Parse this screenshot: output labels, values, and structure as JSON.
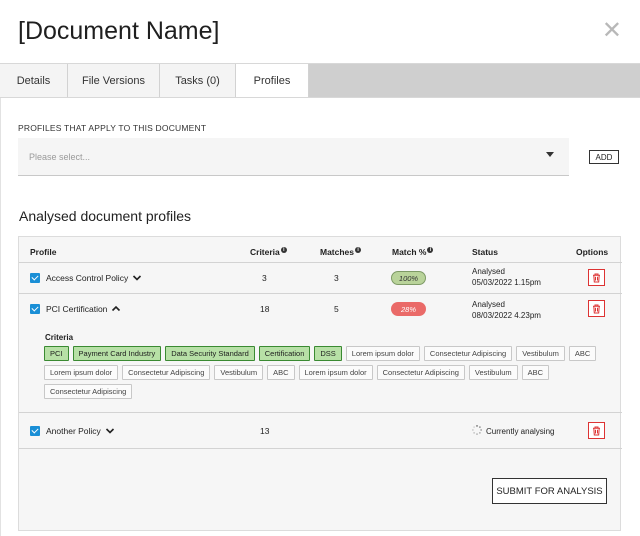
{
  "header": {
    "title": "[Document Name]",
    "close_glyph": "✕"
  },
  "tabs": [
    {
      "label": "Details"
    },
    {
      "label": "File Versions"
    },
    {
      "label": "Tasks (0)"
    },
    {
      "label": "Profiles",
      "active": true
    }
  ],
  "profiles_section": {
    "label": "PROFILES THAT APPLY TO THIS DOCUMENT",
    "select_placeholder": "Please select...",
    "add_label": "ADD"
  },
  "analysed": {
    "heading": "Analysed document profiles",
    "columns": {
      "profile": "Profile",
      "criteria": "Criteria",
      "matches": "Matches",
      "match_pct": "Match %",
      "status": "Status",
      "options": "Options"
    },
    "rows": [
      {
        "name": "Access Control Policy",
        "criteria": "3",
        "matches": "3",
        "match": "100%",
        "status_line1": "Analysed",
        "status_line2": "05/03/2022  1.15pm"
      },
      {
        "name": "PCI Certification",
        "criteria": "18",
        "matches": "5",
        "match": "28%",
        "status_line1": "Analysed",
        "status_line2": "08/03/2022  4.23pm",
        "criteria_label": "Criteria",
        "tags": [
          {
            "text": "PCI",
            "hl": true
          },
          {
            "text": "Payment Card Industry",
            "hl": true
          },
          {
            "text": "Data Security Standard",
            "hl": true
          },
          {
            "text": "Certification",
            "hl": true
          },
          {
            "text": "DSS",
            "hl": true
          },
          {
            "text": "Lorem ipsum dolor",
            "hl": false
          },
          {
            "text": "Consectetur Adipiscing",
            "hl": false
          },
          {
            "text": "Vestibulum",
            "hl": false
          },
          {
            "text": "ABC",
            "hl": false
          },
          {
            "text": "Lorem ipsum dolor",
            "hl": false
          },
          {
            "text": "Consectetur Adipiscing",
            "hl": false
          },
          {
            "text": "Vestibulum",
            "hl": false
          },
          {
            "text": "ABC",
            "hl": false
          },
          {
            "text": "Lorem ipsum dolor",
            "hl": false
          },
          {
            "text": "Consectetur Adipiscing",
            "hl": false
          },
          {
            "text": "Vestibulum",
            "hl": false
          },
          {
            "text": "ABC",
            "hl": false
          },
          {
            "text": "Consectetur Adipiscing",
            "hl": false
          }
        ]
      },
      {
        "name": "Another Policy",
        "criteria": "13",
        "status": "Currently analysing"
      }
    ],
    "submit_label": "SUBMIT FOR ANALYSIS"
  },
  "colors": {
    "accent": "#1a8fd6",
    "green_tag": "#b7e0a6",
    "red_pill": "#ea6a68",
    "green_pill": "#b9d39a",
    "delete": "#dd3333"
  },
  "icons": [
    "close-icon",
    "chevron-down-icon",
    "chevron-up-icon",
    "info-icon",
    "trash-icon",
    "spinner-icon",
    "checkbox-checked-icon"
  ]
}
